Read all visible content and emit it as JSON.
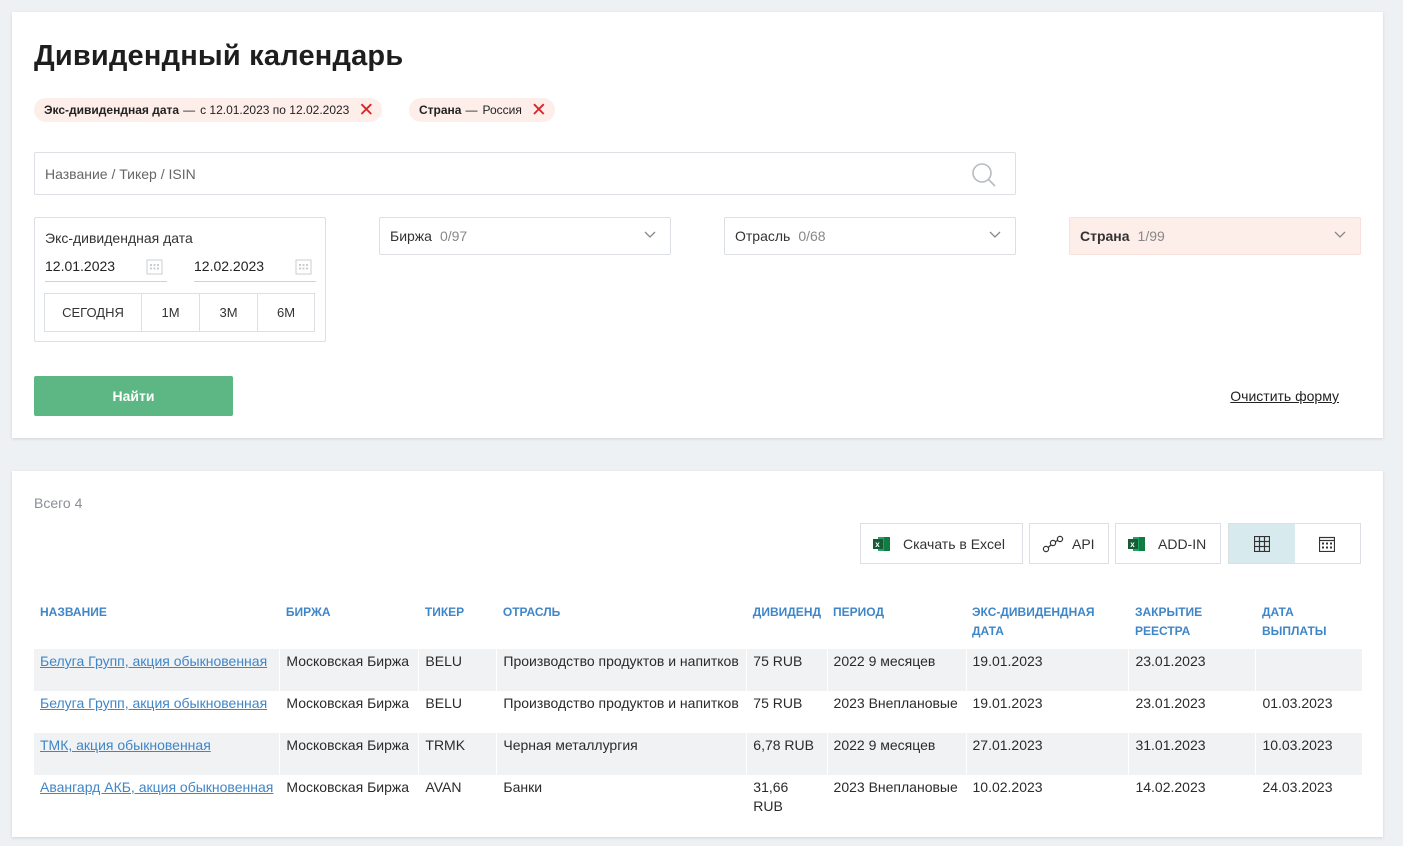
{
  "page": {
    "title": "Дивидендный календарь"
  },
  "chips": [
    {
      "label": "Экс-дивидендная дата",
      "sep": "—",
      "value": "с 12.01.2023 по 12.02.2023"
    },
    {
      "label": "Страна",
      "sep": "—",
      "value": "Россия"
    }
  ],
  "search": {
    "placeholder": "Название / Тикер / ISIN"
  },
  "date_filter": {
    "label": "Экс-дивидендная дата",
    "from": "12.01.2023",
    "to": "12.02.2023",
    "ranges": [
      "СЕГОДНЯ",
      "1М",
      "3М",
      "6М"
    ]
  },
  "dropdowns": [
    {
      "name": "Биржа",
      "count": "0/97"
    },
    {
      "name": "Отрасль",
      "count": "0/68"
    },
    {
      "name": "Страна",
      "count": "1/99"
    }
  ],
  "actions": {
    "find": "Найти",
    "clear": "Очистить форму"
  },
  "results": {
    "total": "Всего 4",
    "excel": "Скачать в Excel",
    "api": "API",
    "addin": "ADD-IN"
  },
  "table": {
    "headers": [
      "НАЗВАНИЕ",
      "БИРЖА",
      "ТИКЕР",
      "ОТРАСЛЬ",
      "ДИВИДЕНД",
      "ПЕРИОД",
      "ЭКС-ДИВИДЕНДНАЯ ДАТА",
      "ЗАКРЫТИЕ РЕЕСТРА",
      "ДАТА ВЫПЛАТЫ"
    ],
    "rows": [
      {
        "name": "Белуга Групп, акция обыкновенная",
        "exchange": "Московская Биржа",
        "ticker": "BELU",
        "industry": "Производство продуктов и напитков",
        "dividend": "75 RUB",
        "period": "2022 9 месяцев",
        "ex_date": "19.01.2023",
        "record": "23.01.2023",
        "pay": ""
      },
      {
        "name": "Белуга Групп, акция обыкновенная",
        "exchange": "Московская Биржа",
        "ticker": "BELU",
        "industry": "Производство продуктов и напитков",
        "dividend": "75 RUB",
        "period": "2023 Внеплановые",
        "ex_date": "19.01.2023",
        "record": "23.01.2023",
        "pay": "01.03.2023"
      },
      {
        "name": "ТМК, акция обыкновенная",
        "exchange": "Московская Биржа",
        "ticker": "TRMK",
        "industry": "Черная металлургия",
        "dividend": "6,78 RUB",
        "period": "2022 9 месяцев",
        "ex_date": "27.01.2023",
        "record": "31.01.2023",
        "pay": "10.03.2023"
      },
      {
        "name": "Авангард АКБ, акция обыкновенная",
        "exchange": "Московская Биржа",
        "ticker": "AVAN",
        "industry": "Банки",
        "dividend": "31,66 RUB",
        "period": "2023 Внеплановые",
        "ex_date": "10.02.2023",
        "record": "14.02.2023",
        "pay": "24.03.2023"
      }
    ]
  },
  "colors": {
    "accent_link": "#3f86c8",
    "find_button": "#5cb784",
    "chip_bg": "#fdeeea",
    "remove_x": "#d8252a"
  },
  "icons": [
    "close-icon",
    "search-icon",
    "calendar-icon",
    "chevron-down-icon",
    "excel-icon",
    "api-link-icon",
    "table-view-icon",
    "calendar-view-icon"
  ]
}
